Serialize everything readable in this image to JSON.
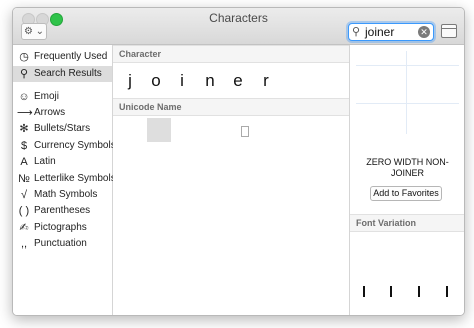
{
  "window": {
    "title": "Characters"
  },
  "toolbar": {
    "action_icon": "gear-icon",
    "search": {
      "value": "joiner",
      "icon": "magnifier-icon",
      "clear_icon": "clear-icon"
    },
    "sidebar_toggle_icon": "sidebar-icon"
  },
  "sidebar": {
    "items": [
      {
        "label": "Frequently Used",
        "icon": "clock-icon",
        "glyph": "◷"
      },
      {
        "label": "Search Results",
        "icon": "magnifier-icon",
        "glyph": "⚲",
        "selected": true
      },
      {
        "label": "Emoji",
        "icon": "smiley-icon",
        "glyph": "☺"
      },
      {
        "label": "Arrows",
        "icon": "arrow-icon",
        "glyph": "⟶"
      },
      {
        "label": "Bullets/Stars",
        "icon": "asterisk-icon",
        "glyph": "✻"
      },
      {
        "label": "Currency Symbols",
        "icon": "dollar-icon",
        "glyph": "$"
      },
      {
        "label": "Latin",
        "icon": "latin-icon",
        "glyph": "A"
      },
      {
        "label": "Letterlike Symbols",
        "icon": "numero-icon",
        "glyph": "№"
      },
      {
        "label": "Math Symbols",
        "icon": "square-root-icon",
        "glyph": "√"
      },
      {
        "label": "Parentheses",
        "icon": "parentheses-icon",
        "glyph": "( )"
      },
      {
        "label": "Pictographs",
        "icon": "pictograph-icon",
        "glyph": "✍"
      },
      {
        "label": "Punctuation",
        "icon": "punctuation-icon",
        "glyph": ",,"
      }
    ]
  },
  "main": {
    "character_header": "Character",
    "glyphs": [
      "j",
      "o",
      "i",
      "n",
      "e",
      "r"
    ],
    "unicode_header": "Unicode Name"
  },
  "inspector": {
    "character_name": "ZERO WIDTH NON-JOINER",
    "add_favorites_label": "Add to Favorites",
    "font_variation_header": "Font Variation"
  }
}
